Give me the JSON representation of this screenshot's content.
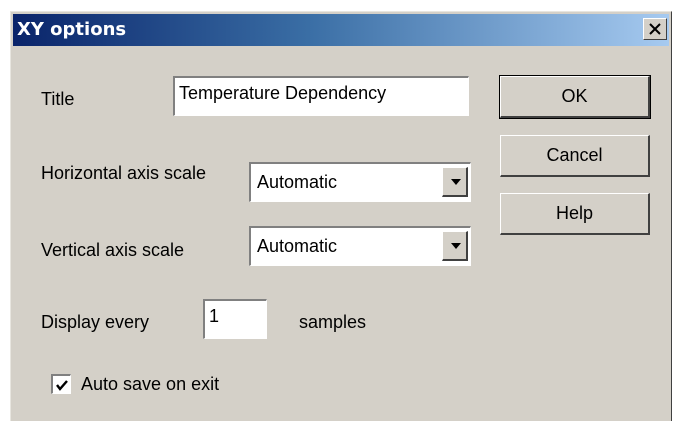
{
  "window": {
    "title": "XY options",
    "close_glyph": "close-icon"
  },
  "form": {
    "title_label": "Title",
    "title_value": "Temperature Dependency",
    "horizontal_label": "Horizontal axis scale",
    "horizontal_value": "Automatic",
    "vertical_label": "Vertical axis scale",
    "vertical_value": "Automatic",
    "display_label": "Display every",
    "display_value": "1",
    "display_suffix": "samples",
    "autosave_label": "Auto save on exit",
    "autosave_checked": true
  },
  "buttons": {
    "ok": "OK",
    "cancel": "Cancel",
    "help": "Help"
  },
  "colors": {
    "title_start": "#0a246a",
    "title_end": "#a6caf0",
    "face": "#d4d0c8"
  }
}
